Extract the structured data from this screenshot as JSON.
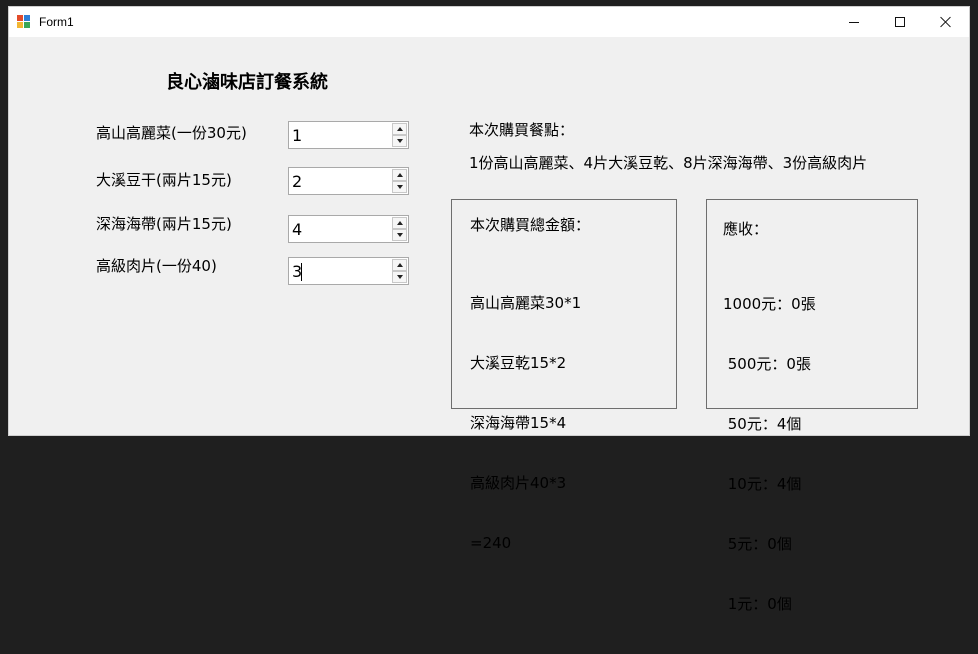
{
  "window": {
    "title": "Form1",
    "minimize_icon": "minimize-icon",
    "maximize_icon": "maximize-icon",
    "close_icon": "close-icon"
  },
  "heading": "良心滷味店訂餐系統",
  "items": [
    {
      "label": "高山高麗菜(一份30元)",
      "value": "1"
    },
    {
      "label": "大溪豆干(兩片15元)",
      "value": "2"
    },
    {
      "label": "深海海帶(兩片15元)",
      "value": "4"
    },
    {
      "label": "高級肉片(一份40)",
      "value": "3"
    }
  ],
  "order": {
    "title": "本次購買餐點：",
    "summary": "1份高山高麗菜、4片大溪豆乾、8片深海海帶、3份高級肉片"
  },
  "total": {
    "title": "本次購買總金額：",
    "lines": [
      "高山高麗菜30*1",
      "大溪豆乾15*2",
      "深海海帶15*4",
      "高級肉片40*3",
      "=240"
    ]
  },
  "change": {
    "title": "應收：",
    "lines": [
      "1000元：0張",
      " 500元：0張",
      " 50元：4個",
      " 10元：4個",
      " 5元：0個",
      " 1元：0個"
    ]
  }
}
